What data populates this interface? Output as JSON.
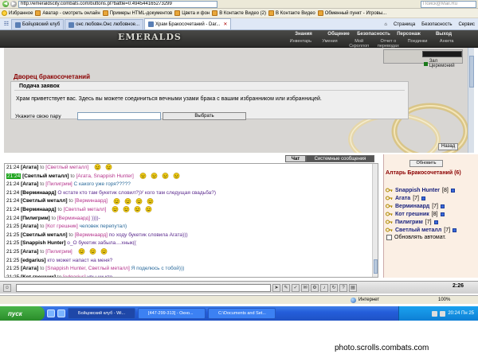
{
  "browser": {
    "url": "http://emeraldscity.combats.com/buttons.pl?battle=0.494544165273299",
    "search_text": "Поиск@Mail.Ru",
    "favorites": [
      "Избранное",
      "Аватар - смотреть онлайн",
      "Примеры HTML-документов",
      "Цвета и фон",
      "В Контакте Видео (2)",
      "В Контакте Видео",
      "Обменный пункт - Игровы..."
    ],
    "tabs": [
      {
        "label": "Бойцовский клуб"
      },
      {
        "label": "онс любовн.Онс любовное..."
      },
      {
        "label": "Храм Бракосочетаний - Dar..."
      }
    ],
    "commands": [
      "Страница",
      "Безопасность",
      "Сервис"
    ]
  },
  "game": {
    "logo": "EMERALDS",
    "topnav": [
      "Знания",
      "Общение",
      "Безопасность",
      "Персонаж",
      "Выход"
    ],
    "subnav": [
      "Инвентарь",
      "Умения",
      "Мой Скроллоп",
      "Отчет о переводах",
      "Поединки",
      "Анкета"
    ],
    "location": "Зал Церемоний"
  },
  "temple": {
    "title": "Дворец бракосочетаний",
    "section": "Подача заявок",
    "welcome": "Храм приветствует вас. Здесь вы можете соединиться вечными узами брака с вашим избранником или избранницей.",
    "partner_label": "Укажите свою пару",
    "choose_btn": "Выбрать",
    "back_btn": "Назад"
  },
  "chat_tabs": {
    "chat": "Чат",
    "system": "Системные сообщения"
  },
  "chat": [
    {
      "time": "21:24",
      "hl": false,
      "nick": "[Агата]",
      "to": "to",
      "rcpt": "[Светлый металл]",
      "text": "",
      "smileys": 2
    },
    {
      "time": "21:24",
      "hl": true,
      "nick": "[Светлый металл]",
      "to": "to",
      "rcpt": "[Агата, Snappish Hunter]",
      "text": "",
      "smileys": 4
    },
    {
      "time": "21:24",
      "hl": false,
      "nick": "[Агата]",
      "to": "to",
      "rcpt": "[Пилигрим]",
      "text": "С какого уже горя?????",
      "style": "teal",
      "smileys": 0
    },
    {
      "time": "21:24",
      "hl": false,
      "nick": "[Верминаард]",
      "to": "",
      "rcpt": "",
      "text": "О кстате кто там букетик словил?)У кого там следущая свадьба?)",
      "style": "purple",
      "smileys": 0
    },
    {
      "time": "21:24",
      "hl": false,
      "nick": "[Светлый металл]",
      "to": "to",
      "rcpt": "[Верминаард]",
      "text": "",
      "smileys": 4
    },
    {
      "time": "21:24",
      "hl": false,
      "nick": "[Верминаард]",
      "to": "to",
      "rcpt": "[Светлый металл]",
      "text": "",
      "smileys": 4
    },
    {
      "time": "21:24",
      "hl": false,
      "nick": "[Пилигрим]",
      "to": "to",
      "rcpt": "[Верминаард]",
      "text": "))))-",
      "style": "purple",
      "smileys": 0
    },
    {
      "time": "21:25",
      "hl": false,
      "nick": "[Агата]",
      "to": "to",
      "rcpt": "[Кот грешник]",
      "text": "человек перепутал)",
      "style": "teal",
      "smileys": 0
    },
    {
      "time": "21:25",
      "hl": false,
      "nick": "[Светлый металл]",
      "to": "to",
      "rcpt": "[Верминаард]",
      "text": "по ходу букетик словила Агата)))",
      "style": "purple",
      "smileys": 0
    },
    {
      "time": "21:25",
      "hl": false,
      "nick": "[Snappish Hunter]",
      "to": "",
      "rcpt": "",
      "text": "о_О букетик забыла....хнык((",
      "style": "purple",
      "smileys": 0
    },
    {
      "time": "21:25",
      "hl": false,
      "nick": "[Агата]",
      "to": "to",
      "rcpt": "[Пилигрим]",
      "text": "",
      "smileys": 3
    },
    {
      "time": "21:25",
      "hl": false,
      "nick": "[edgarius]",
      "to": "",
      "rcpt": "",
      "text": "кто может напаст на меня?",
      "style": "purple",
      "smileys": 0
    },
    {
      "time": "21:25",
      "hl": false,
      "nick": "[Агата]",
      "to": "to",
      "rcpt": "[Snappish Hunter, Светлый металл]",
      "text": "Я поделюсь с тобой)))",
      "style": "teal",
      "smileys": 0
    },
    {
      "time": "21:25",
      "hl": false,
      "nick": "[Кот грешник]",
      "to": "to",
      "rcpt": "[edgarius]",
      "text": "увы ни кто",
      "style": "purple",
      "smileys": 0
    }
  ],
  "panel": {
    "refresh": "Обновить",
    "title": "Алтарь Бракосочетаний (6)",
    "users": [
      {
        "name": "Snappish Hunter",
        "level": "[8]"
      },
      {
        "name": "Агата",
        "level": "[7]"
      },
      {
        "name": "Верминаард",
        "level": "[7]"
      },
      {
        "name": "Кот грешник",
        "level": "[8]"
      },
      {
        "name": "Пилигрим",
        "level": "[7]"
      },
      {
        "name": "Светлый металл",
        "level": "[7]"
      }
    ],
    "auto": "Обновлять автомат."
  },
  "clock": "2:26",
  "status": {
    "zone": "Интернет",
    "zoom": "100%"
  },
  "taskbar": {
    "start": "пуск",
    "tasks": [
      "Бойцовский клуб - Wi...",
      "[447-299-313] - Окно...",
      "C:\\Documents and Set..."
    ],
    "time": "20:24 Пн 25"
  },
  "watermark": "photo.scrolls.combats.com"
}
